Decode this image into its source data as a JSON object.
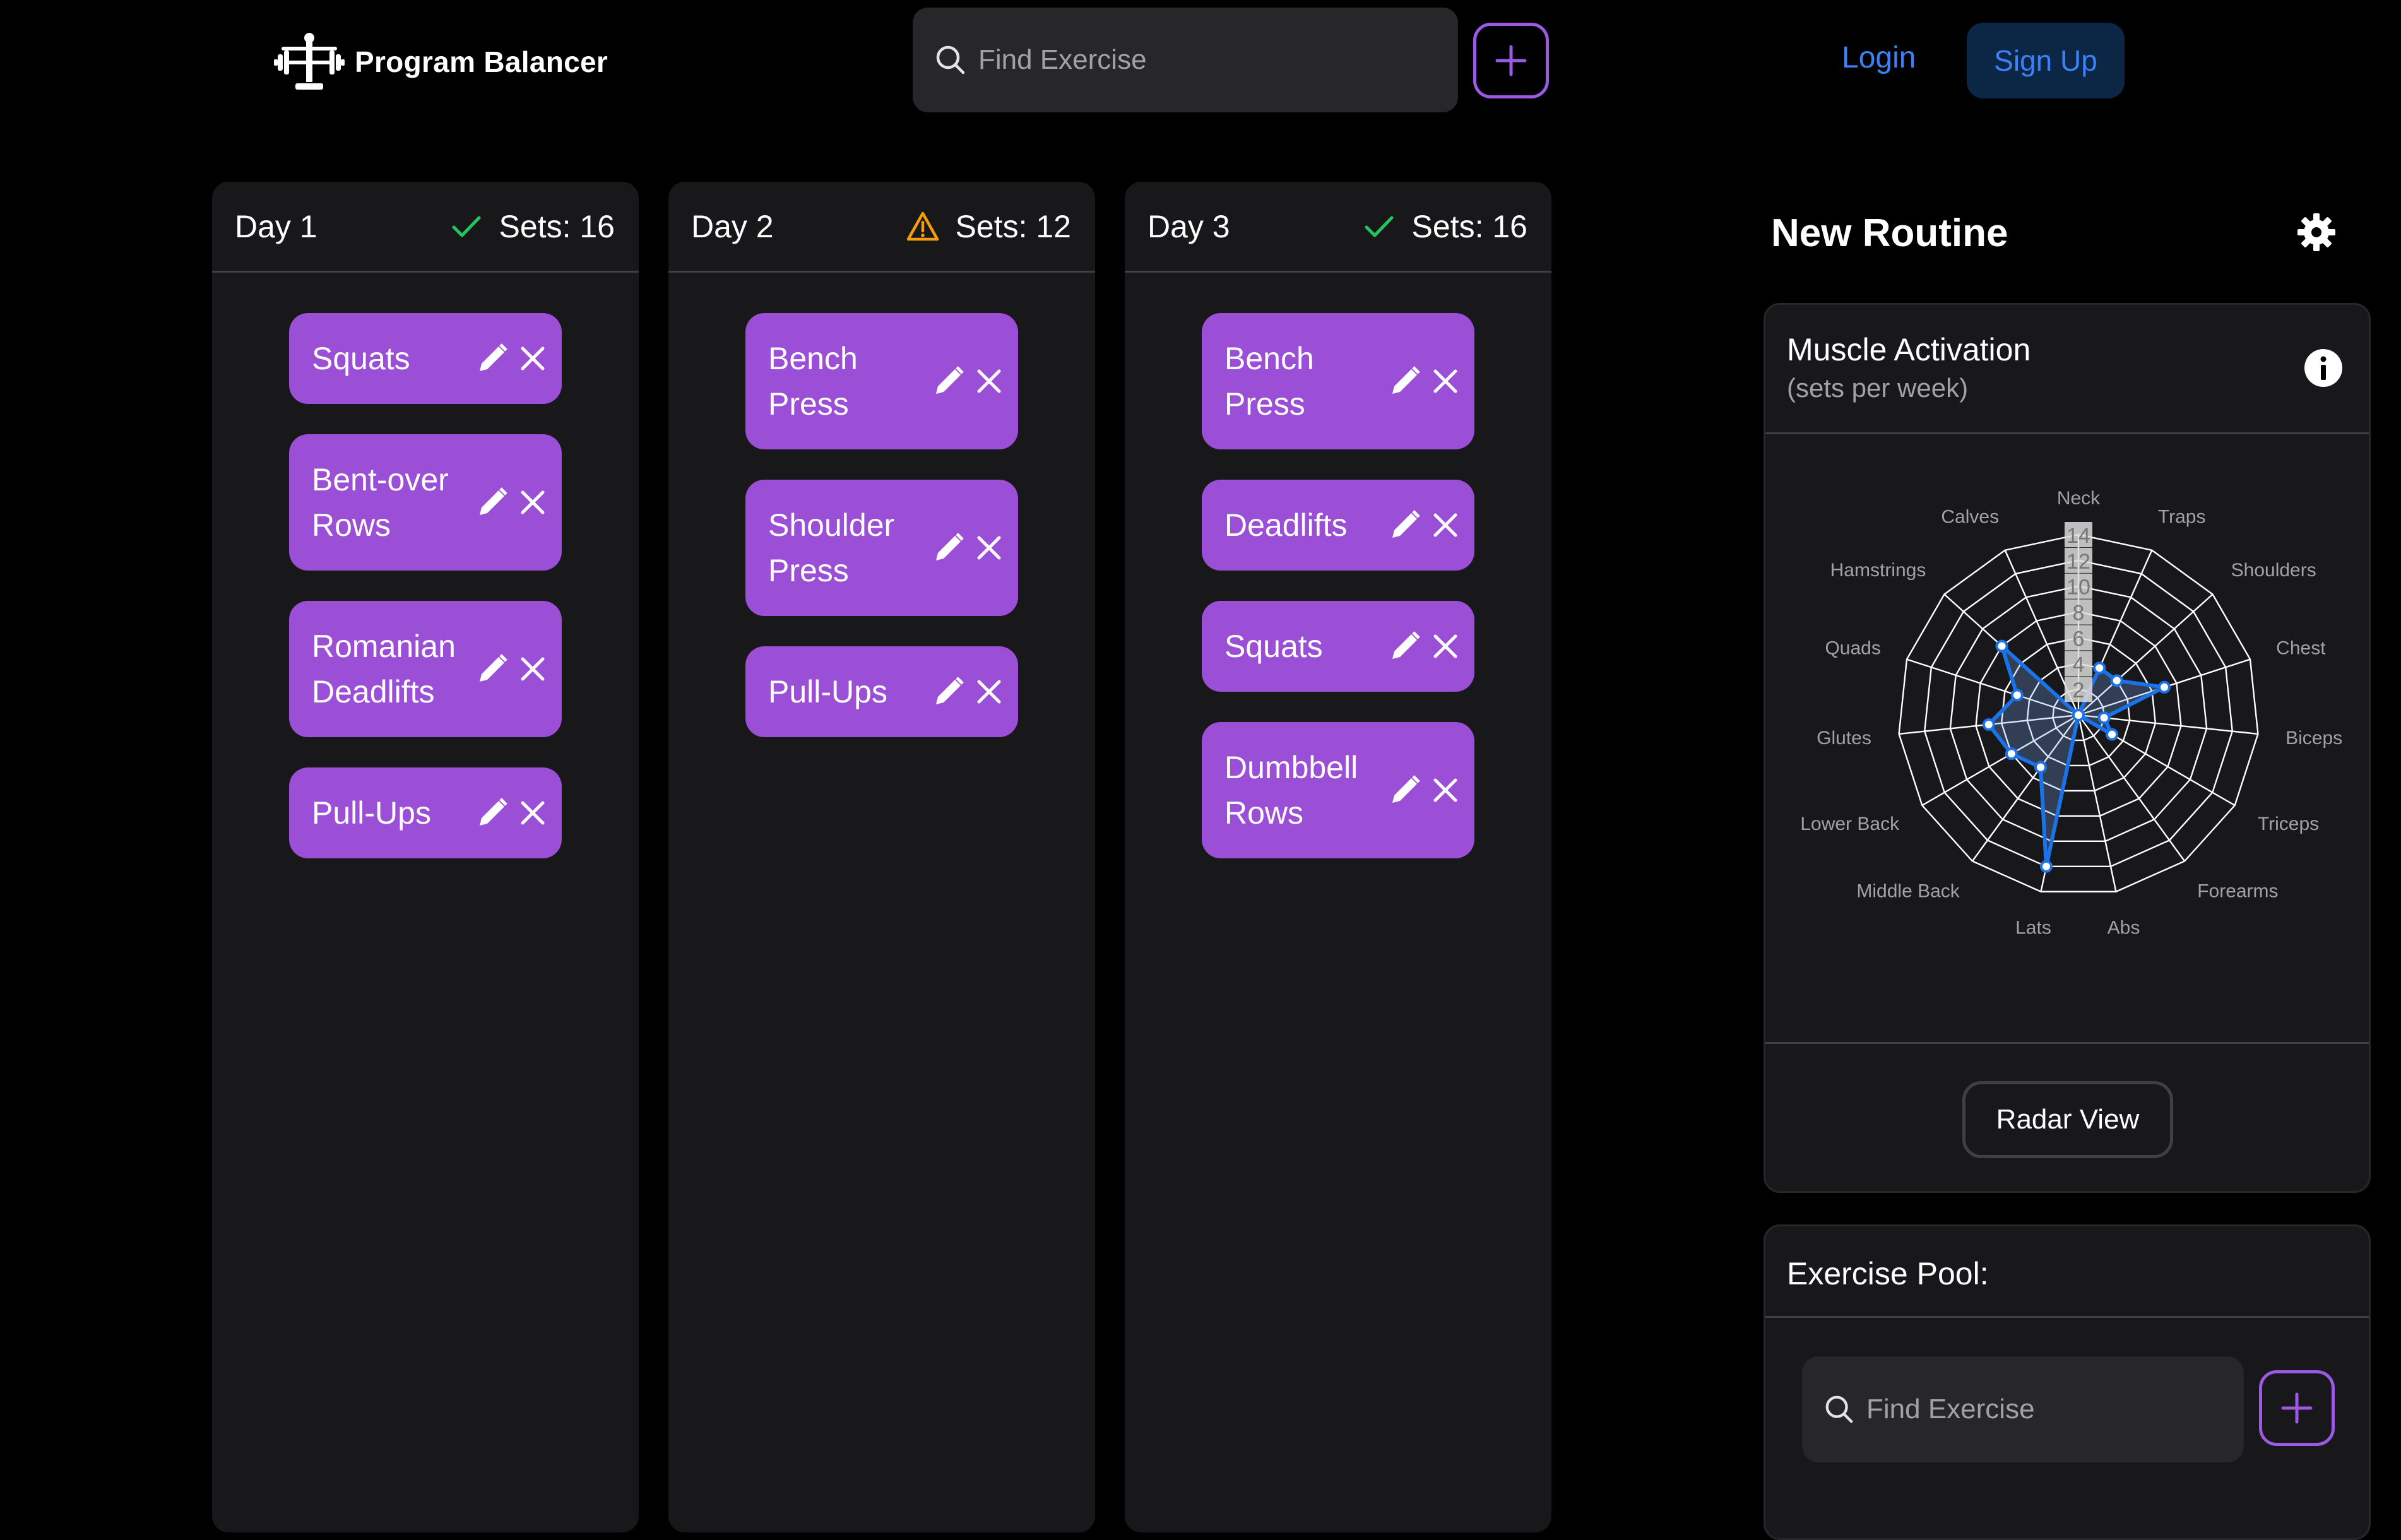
{
  "header": {
    "app_name": "Program Balancer",
    "search_placeholder": "Find Exercise",
    "login_label": "Login",
    "signup_label": "Sign Up"
  },
  "colors": {
    "accent_purple": "#9b4fd6",
    "link_blue": "#3b82f6",
    "ok_green": "#22c55e",
    "warn_orange": "#f59e0b",
    "panel": "#18181b"
  },
  "days": [
    {
      "label": "Day 1",
      "sets_label": "Sets: 16",
      "status": "check-icon",
      "exercises": [
        {
          "name": "Squats"
        },
        {
          "name": "Bent-over Rows"
        },
        {
          "name": "Romanian Deadlifts"
        },
        {
          "name": "Pull-Ups"
        }
      ]
    },
    {
      "label": "Day 2",
      "sets_label": "Sets: 12",
      "status": "warning-icon",
      "exercises": [
        {
          "name": "Bench Press"
        },
        {
          "name": "Shoulder Press"
        },
        {
          "name": "Pull-Ups"
        }
      ]
    },
    {
      "label": "Day 3",
      "sets_label": "Sets: 16",
      "status": "check-icon",
      "exercises": [
        {
          "name": "Bench Press"
        },
        {
          "name": "Deadlifts"
        },
        {
          "name": "Squats"
        },
        {
          "name": "Dumbbell Rows"
        }
      ]
    }
  ],
  "routine": {
    "title": "New Routine",
    "activation_title": "Muscle Activation",
    "activation_subtitle": "(sets per week)",
    "radar_view_label": "Radar View"
  },
  "pool": {
    "title": "Exercise Pool:",
    "search_placeholder": "Find Exercise"
  },
  "chart_data": {
    "type": "radar",
    "title": "Muscle Activation",
    "subtitle": "(sets per week)",
    "categories": [
      "Neck",
      "Traps",
      "Shoulders",
      "Chest",
      "Biceps",
      "Triceps",
      "Forearms",
      "Abs",
      "Lats",
      "Middle Back",
      "Lower Back",
      "Glutes",
      "Quads",
      "Hamstrings",
      "Calves"
    ],
    "values": [
      0,
      4,
      4,
      7,
      2,
      3,
      0,
      0,
      12,
      5,
      6,
      7,
      5,
      8,
      0
    ],
    "rlim": [
      0,
      14
    ],
    "ticks": [
      "2",
      "4",
      "6",
      "8",
      "10",
      "12",
      "14"
    ],
    "series_color": "#1a73e8",
    "grid": true
  }
}
